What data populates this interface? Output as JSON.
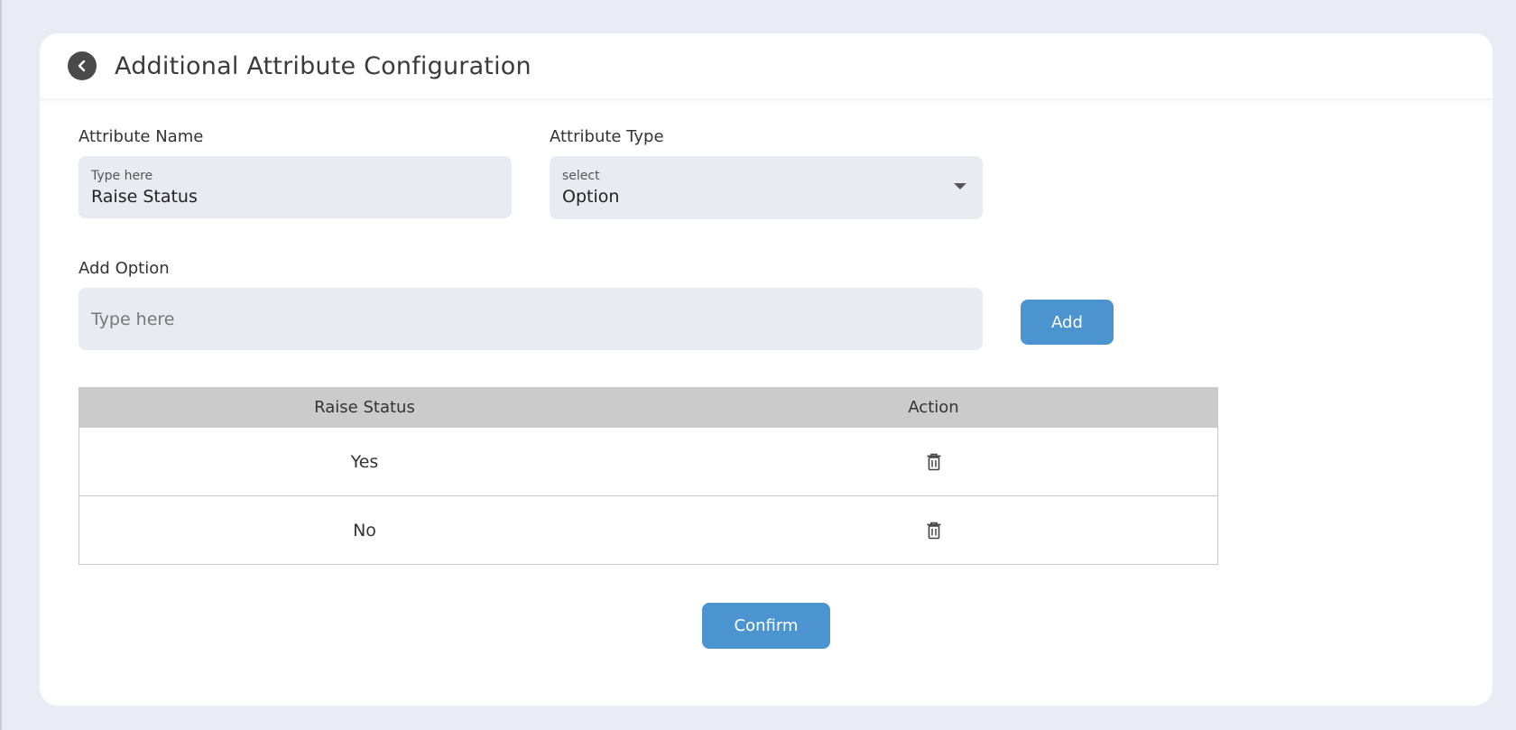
{
  "header": {
    "title": "Additional Attribute Configuration"
  },
  "form": {
    "attribute_name": {
      "label": "Attribute Name",
      "hint": "Type here",
      "value": "Raise Status"
    },
    "attribute_type": {
      "label": "Attribute Type",
      "hint": "select",
      "value": "Option"
    },
    "add_option": {
      "label": "Add Option",
      "placeholder": "Type here",
      "value": ""
    },
    "add_button": "Add"
  },
  "table": {
    "headers": [
      "Raise Status",
      "Action"
    ],
    "rows": [
      {
        "value": "Yes",
        "action_icon": "trash-icon"
      },
      {
        "value": "No",
        "action_icon": "trash-icon"
      }
    ]
  },
  "confirm_button": "Confirm",
  "colors": {
    "accent": "#4b94d0",
    "background": "#e9ecf4",
    "table_header": "#cbcbcb"
  }
}
